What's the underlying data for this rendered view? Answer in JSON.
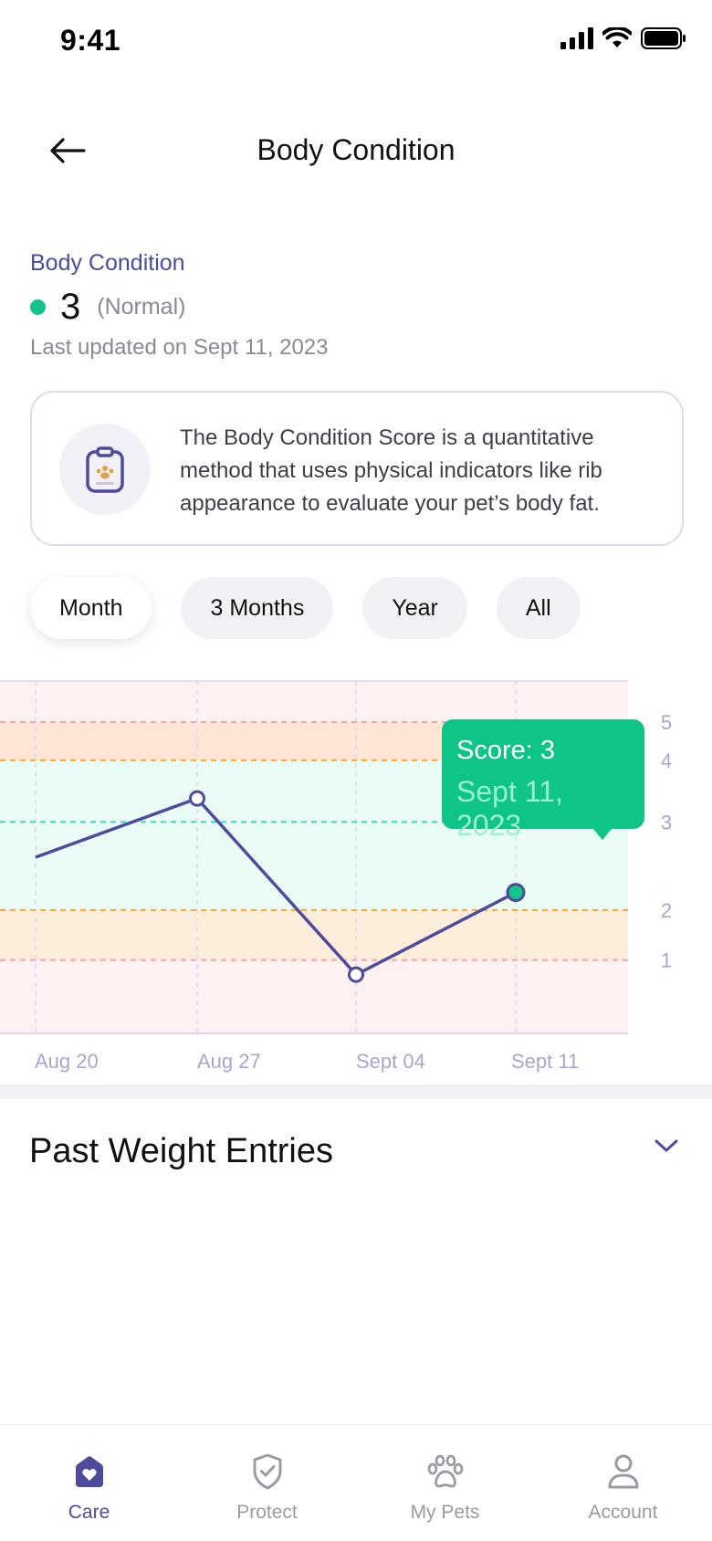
{
  "status_bar": {
    "time": "9:41"
  },
  "header": {
    "title": "Body Condition"
  },
  "body_condition": {
    "label": "Body Condition",
    "score": "3",
    "status": "(Normal)",
    "last_updated": "Last updated on Sept 11, 2023"
  },
  "info_card": {
    "icon": "clipboard-paw-icon",
    "text": "The Body Condition Score is a quantitative method that uses physical indicators like rib appearance to evaluate your pet’s body fat."
  },
  "range_tabs": [
    {
      "label": "Month",
      "active": true
    },
    {
      "label": "3 Months",
      "active": false
    },
    {
      "label": "Year",
      "active": false
    },
    {
      "label": "All",
      "active": false
    }
  ],
  "chart_data": {
    "type": "line",
    "categories": [
      "Aug 20",
      "Aug 27",
      "Sept 04",
      "Sept 11"
    ],
    "series": [
      {
        "values": [
          3,
          4,
          1,
          2.4
        ]
      }
    ],
    "y_ticks": [
      "1",
      "2",
      "3",
      "4",
      "5"
    ],
    "ylim": [
      0,
      6
    ],
    "grid": true,
    "colors": {
      "line": "#4e4a9c",
      "highlight": "#12c48b"
    },
    "tooltip": {
      "score": "Score: 3",
      "date": "Sept 11, 2023"
    }
  },
  "past_entries": {
    "title": "Past Weight Entries"
  },
  "tab_bar": {
    "items": [
      {
        "label": "Care",
        "icon": "heart-house-icon",
        "active": true
      },
      {
        "label": "Protect",
        "icon": "shield-check-icon",
        "active": false
      },
      {
        "label": "My Pets",
        "icon": "paw-icon",
        "active": false
      },
      {
        "label": "Account",
        "icon": "user-icon",
        "active": false
      }
    ]
  }
}
